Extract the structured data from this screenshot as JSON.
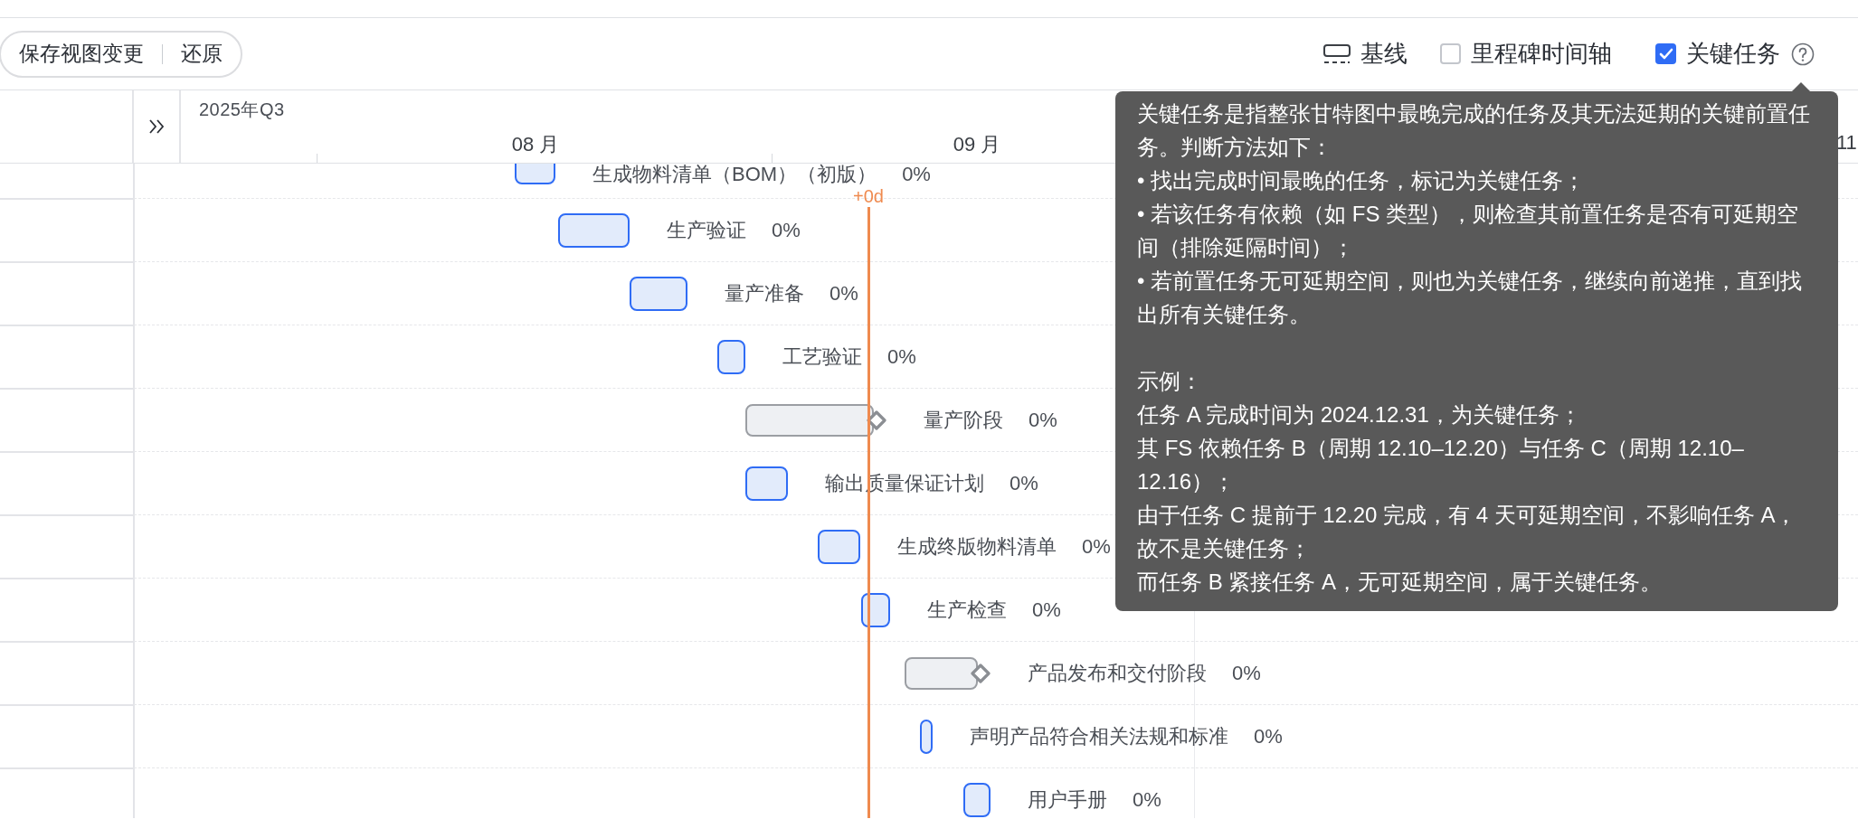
{
  "toolbar": {
    "view_actions": [
      {
        "label": "保存视图变更"
      },
      {
        "label": "还原"
      }
    ],
    "options": [
      {
        "kind": "toggle",
        "label": "基线"
      },
      {
        "kind": "checkbox",
        "label": "里程碑时间轴",
        "checked": false
      },
      {
        "kind": "checkbox",
        "label": "关键任务",
        "checked": true,
        "help": true
      }
    ]
  },
  "timeline": {
    "quarter": "2025年Q3",
    "months": [
      "08 月",
      "09 月",
      "11"
    ],
    "today_label": "+0d"
  },
  "tasks": [
    {
      "kind": "task",
      "name": "生成物料清单（BOM）（初版）",
      "progress": "0%"
    },
    {
      "kind": "task",
      "name": "生产验证",
      "progress": "0%"
    },
    {
      "kind": "task",
      "name": "量产准备",
      "progress": "0%"
    },
    {
      "kind": "task",
      "name": "工艺验证",
      "progress": "0%"
    },
    {
      "kind": "summary",
      "name": "量产阶段",
      "progress": "0%"
    },
    {
      "kind": "task",
      "name": "输出质量保证计划",
      "progress": "0%"
    },
    {
      "kind": "task",
      "name": "生成终版物料清单",
      "progress": "0%"
    },
    {
      "kind": "task",
      "name": "生产检查",
      "progress": "0%"
    },
    {
      "kind": "summary",
      "name": "产品发布和交付阶段",
      "progress": "0%"
    },
    {
      "kind": "task",
      "name": "声明产品符合相关法规和标准",
      "progress": "0%"
    },
    {
      "kind": "task",
      "name": "用户手册",
      "progress": "0%"
    }
  ],
  "tooltip": {
    "paragraphs": [
      "关键任务是指整张甘特图中最晚完成的任务及其无法延期的关键前置任务。判断方法如下：",
      "• 找出完成时间最晚的任务，标记为关键任务；",
      "• 若该任务有依赖（如 FS 类型），则检查其前置任务是否有可延期空间（排除延隔时间）；",
      "• 若前置任务无可延期空间，则也为关键任务，继续向前递推，直到找出所有关键任务。",
      "示例：",
      "任务 A 完成时间为 2024.12.31，为关键任务；",
      "其 FS 依赖任务 B（周期 12.10–12.20）与任务 C（周期 12.10–12.16）；",
      "由于任务 C 提前于 12.20 完成，有 4 天可延期空间，不影响任务 A，故不是关键任务；",
      "而任务 B 紧接任务 A，无可延期空间，属于关键任务。"
    ]
  }
}
